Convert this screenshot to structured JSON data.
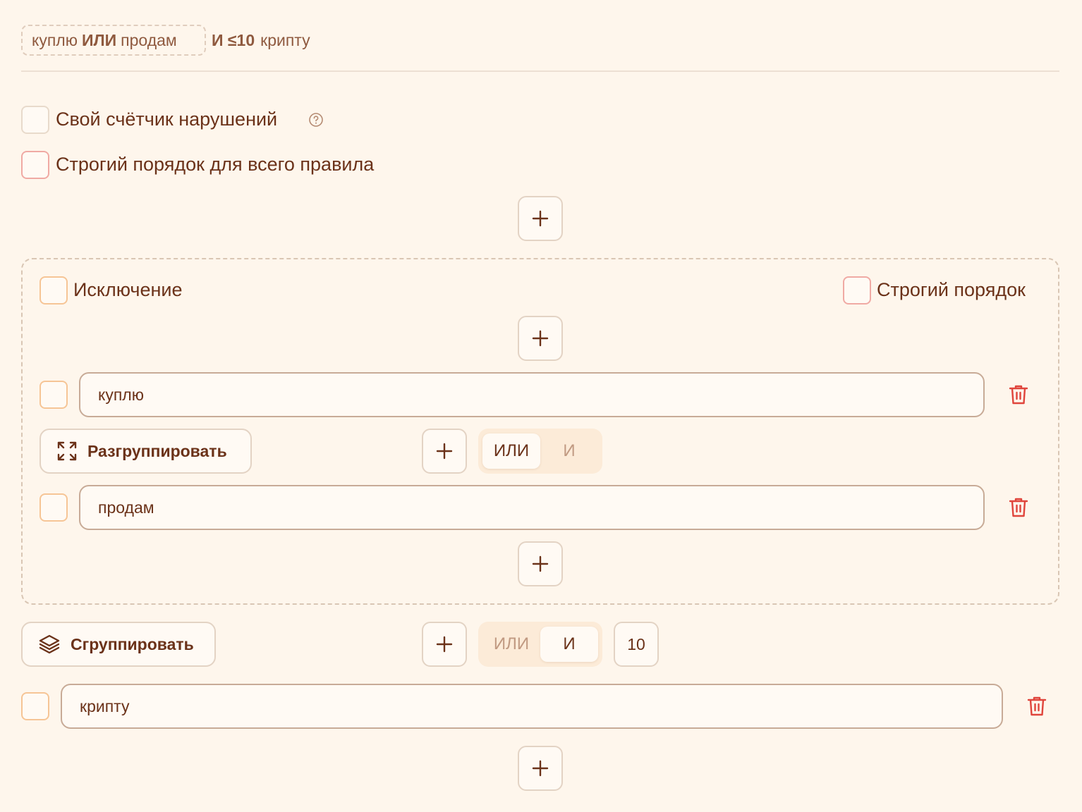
{
  "summary": {
    "group_word1": "куплю",
    "group_op": "ИЛИ",
    "group_word2": "продам",
    "rest_op": "И ≤10",
    "rest_word": "крипту"
  },
  "options": {
    "own_counter_label": "Свой счётчик нарушений",
    "strict_order_rule_label": "Строгий порядок для всего правила"
  },
  "group": {
    "exception_label": "Исключение",
    "strict_order_label": "Строгий порядок",
    "term1": "куплю",
    "term2": "продам",
    "ungroup_label": "Разгруппировать",
    "toggle_or": "ИЛИ",
    "toggle_and": "И",
    "toggle_selected": "ИЛИ"
  },
  "outer": {
    "group_label": "Сгруппировать",
    "toggle_or": "ИЛИ",
    "toggle_and": "И",
    "toggle_selected": "И",
    "count": "10",
    "term3": "крипту"
  },
  "colors": {
    "background": "#fef6ec",
    "text": "#6b3219",
    "danger": "#e0453c"
  }
}
